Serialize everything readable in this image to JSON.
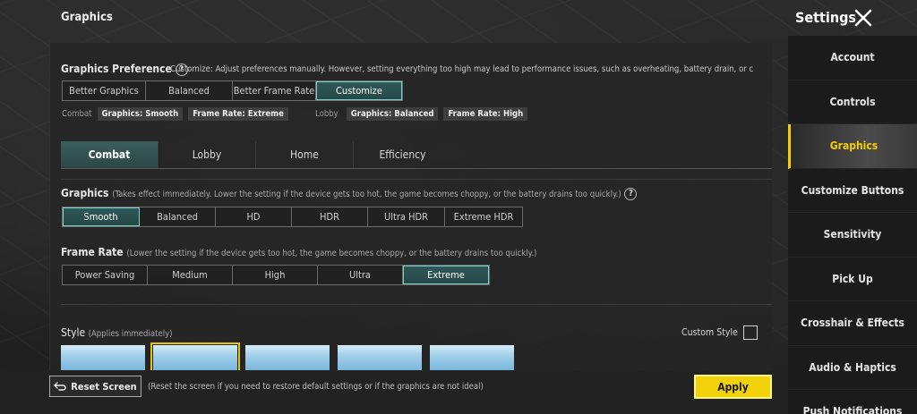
{
  "header": {
    "title": "Graphics",
    "settings_title": "Settings"
  },
  "preference": {
    "label": "Graphics Preference",
    "help": "?",
    "description": "Customize: Adjust preferences manually. However, setting everything too high may lead to performance issues, such as overheating, battery drain, or c",
    "options": [
      "Better Graphics",
      "Balanced",
      "Better Frame Rate",
      "Customize"
    ],
    "selected": "Customize",
    "combat_label": "Combat",
    "combat_tags": [
      "Graphics: Smooth",
      "Frame Rate: Extreme"
    ],
    "lobby_label": "Lobby",
    "lobby_tags": [
      "Graphics: Balanced",
      "Frame Rate: High"
    ]
  },
  "tabs": [
    "Combat",
    "Lobby",
    "Home",
    "Efficiency"
  ],
  "active_tab": "Combat",
  "graphics": {
    "label": "Graphics",
    "note": "(Takes effect immediately. Lower the setting if the device gets too hot, the game becomes choppy, or the battery drains too quickly.)",
    "help": "?",
    "options": [
      "Smooth",
      "Balanced",
      "HD",
      "HDR",
      "Ultra HDR",
      "Extreme HDR"
    ],
    "selected": "Smooth"
  },
  "frame_rate": {
    "label": "Frame Rate",
    "note": "(Lower the setting if the device gets too hot, the game becomes choppy, or the battery drains too quickly.)",
    "options": [
      "Power Saving",
      "Medium",
      "High",
      "Ultra",
      "Extreme"
    ],
    "selected": "Extreme"
  },
  "style": {
    "label": "Style",
    "note": "(Applies immediately)",
    "custom_style_label": "Custom Style",
    "selected_index": 1
  },
  "footer": {
    "reset_label": "Reset Screen",
    "reset_note": "(Reset the screen if you need to restore default settings or if the graphics are not ideal)",
    "apply_label": "Apply"
  },
  "sidebar": {
    "items": [
      "Account",
      "Controls",
      "Graphics",
      "Customize Buttons",
      "Sensitivity",
      "Pick Up",
      "Crosshair & Effects",
      "Audio & Haptics",
      "Push Notifications"
    ],
    "active": "Graphics"
  },
  "colors": {
    "accent": "#f2d30b",
    "selected_teal": "#2f5958",
    "selected_border": "#7fd0c8"
  }
}
